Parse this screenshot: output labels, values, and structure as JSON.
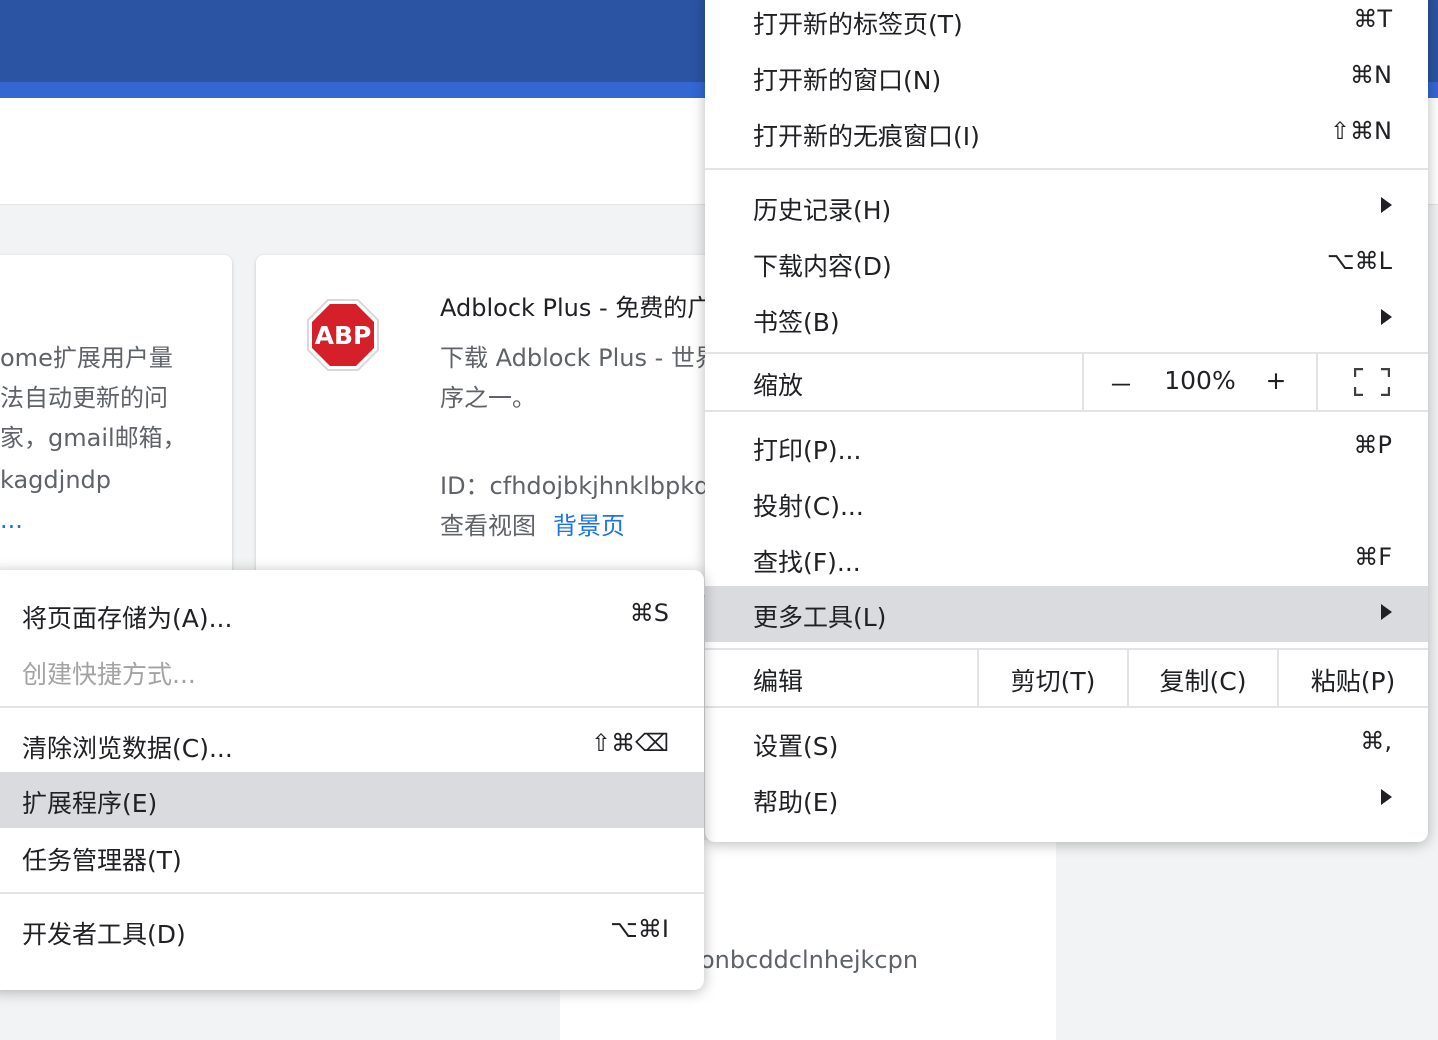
{
  "background_page": {
    "card_left": {
      "lines": [
        "ome扩展用户量",
        "法自动更新的问",
        "家，gmail邮箱，",
        "kagdjndp",
        "..."
      ]
    },
    "card_right": {
      "logo_text": "ABP",
      "title": "Adblock Plus - 免费的广",
      "desc_line1": "下载 Adblock Plus - 世界",
      "desc_line2": "序之一。",
      "id_line": "ID：cfhdojbkjhnklbpkda",
      "views_label": "查看视图",
      "views_link": "背景页"
    },
    "bottom_id_fragment": "onbcddclnhejkcpn"
  },
  "main_menu": {
    "items": [
      {
        "label": "打开新的标签页(T)",
        "shortcut": "⌘T"
      },
      {
        "label": "打开新的窗口(N)",
        "shortcut": "⌘N"
      },
      {
        "label": "打开新的无痕窗口(I)",
        "shortcut": "⇧⌘N"
      },
      {
        "label": "历史记录(H)",
        "submenu": true
      },
      {
        "label": "下载内容(D)",
        "shortcut": "⌥⌘L"
      },
      {
        "label": "书签(B)",
        "submenu": true
      },
      {
        "label": "打印(P)...",
        "shortcut": "⌘P"
      },
      {
        "label": "投射(C)..."
      },
      {
        "label": "查找(F)...",
        "shortcut": "⌘F"
      },
      {
        "label": "更多工具(L)",
        "submenu": true,
        "highlighted": true
      },
      {
        "label": "设置(S)",
        "shortcut": "⌘,"
      },
      {
        "label": "帮助(E)",
        "submenu": true
      }
    ],
    "zoom": {
      "label": "缩放",
      "minus": "－",
      "value": "100%",
      "plus": "+",
      "fullscreen_icon": "fullscreen-icon"
    },
    "edit": {
      "label": "编辑",
      "cut": "剪切(T)",
      "copy": "复制(C)",
      "paste": "粘贴(P)"
    }
  },
  "more_tools_submenu": {
    "items": [
      {
        "label": "将页面存储为(A)...",
        "shortcut": "⌘S"
      },
      {
        "label": "创建快捷方式...",
        "disabled": true
      },
      {
        "label": "清除浏览数据(C)...",
        "shortcut": "⇧⌘⌫"
      },
      {
        "label": "扩展程序(E)",
        "highlighted": true
      },
      {
        "label": "任务管理器(T)"
      },
      {
        "label": "开发者工具(D)",
        "shortcut": "⌥⌘I"
      }
    ]
  },
  "colors": {
    "header_blue": "#2b54a3",
    "highlight_gray": "#dadbdf",
    "abp_red": "#d5202a",
    "link_blue": "#1a73e8"
  }
}
